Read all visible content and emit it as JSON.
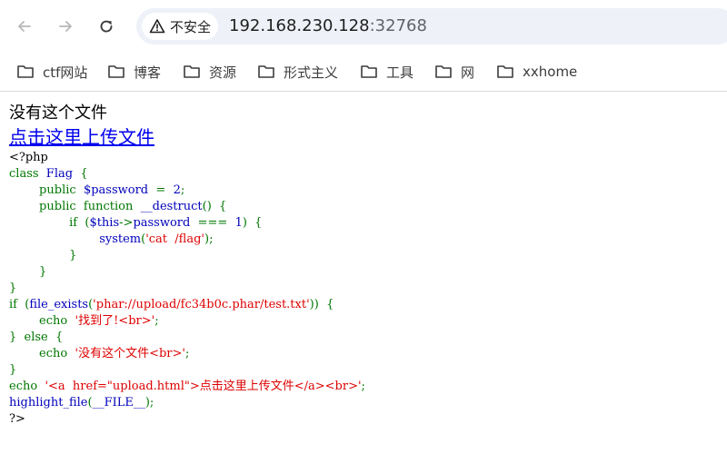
{
  "browser": {
    "security_label": "不安全",
    "url_host": "192.168.230.128",
    "url_port": ":32768"
  },
  "bookmarks": [
    {
      "label": "ctf网站"
    },
    {
      "label": "博客"
    },
    {
      "label": "资源"
    },
    {
      "label": "形式主义"
    },
    {
      "label": "工具"
    },
    {
      "label": "网"
    },
    {
      "label": "xxhome"
    }
  ],
  "page": {
    "message": "没有这个文件",
    "upload_link_text": "点击这里上传文件",
    "code_lines": [
      [
        {
          "t": "<?php",
          "c": "html"
        }
      ],
      [
        {
          "t": "class  ",
          "c": "kw"
        },
        {
          "t": "Flag  ",
          "c": "def"
        },
        {
          "t": "{",
          "c": "kw"
        }
      ],
      [
        {
          "t": "        public  ",
          "c": "kw"
        },
        {
          "t": "$password  ",
          "c": "def"
        },
        {
          "t": "=  ",
          "c": "kw"
        },
        {
          "t": "2",
          "c": "def"
        },
        {
          "t": ";",
          "c": "kw"
        }
      ],
      [
        {
          "t": "        public  function  ",
          "c": "kw"
        },
        {
          "t": "__destruct",
          "c": "def"
        },
        {
          "t": "()  {",
          "c": "kw"
        }
      ],
      [
        {
          "t": "                if  (",
          "c": "kw"
        },
        {
          "t": "$this",
          "c": "def"
        },
        {
          "t": "->",
          "c": "kw"
        },
        {
          "t": "password  ",
          "c": "def"
        },
        {
          "t": "===  ",
          "c": "kw"
        },
        {
          "t": "1",
          "c": "def"
        },
        {
          "t": ")  {",
          "c": "kw"
        }
      ],
      [
        {
          "t": "                        ",
          "c": "kw"
        },
        {
          "t": "system",
          "c": "def"
        },
        {
          "t": "(",
          "c": "kw"
        },
        {
          "t": "'cat  /flag'",
          "c": "str"
        },
        {
          "t": ");",
          "c": "kw"
        }
      ],
      [
        {
          "t": "                }",
          "c": "kw"
        }
      ],
      [
        {
          "t": "        }",
          "c": "kw"
        }
      ],
      [
        {
          "t": "}",
          "c": "kw"
        }
      ],
      [
        {
          "t": "if  (",
          "c": "kw"
        },
        {
          "t": "file_exists",
          "c": "def"
        },
        {
          "t": "(",
          "c": "kw"
        },
        {
          "t": "'phar://upload/fc34b0c.phar/test.txt'",
          "c": "str"
        },
        {
          "t": "))  {",
          "c": "kw"
        }
      ],
      [
        {
          "t": "        echo  ",
          "c": "kw"
        },
        {
          "t": "'找到了!<br>'",
          "c": "str"
        },
        {
          "t": ";",
          "c": "kw"
        }
      ],
      [
        {
          "t": "}  else  {",
          "c": "kw"
        }
      ],
      [
        {
          "t": "        echo  ",
          "c": "kw"
        },
        {
          "t": "'没有这个文件<br>'",
          "c": "str"
        },
        {
          "t": ";",
          "c": "kw"
        }
      ],
      [
        {
          "t": "}",
          "c": "kw"
        }
      ],
      [
        {
          "t": "echo  ",
          "c": "kw"
        },
        {
          "t": "'<a  href=\"upload.html\">点击这里上传文件</a><br>'",
          "c": "str"
        },
        {
          "t": ";",
          "c": "kw"
        }
      ],
      [
        {
          "t": "highlight_file",
          "c": "def"
        },
        {
          "t": "(",
          "c": "kw"
        },
        {
          "t": "__FILE__",
          "c": "def"
        },
        {
          "t": ");",
          "c": "kw"
        }
      ],
      [
        {
          "t": "?>",
          "c": "html"
        }
      ]
    ]
  },
  "colors": {
    "keyword": "#007700",
    "default": "#0000bb",
    "string": "#dd0000",
    "html": "#000000",
    "link": "#0000ee"
  },
  "icons": {
    "back": "back-arrow-icon",
    "forward": "forward-arrow-icon",
    "reload": "reload-icon",
    "security": "warning-triangle-icon",
    "folder": "folder-icon"
  }
}
